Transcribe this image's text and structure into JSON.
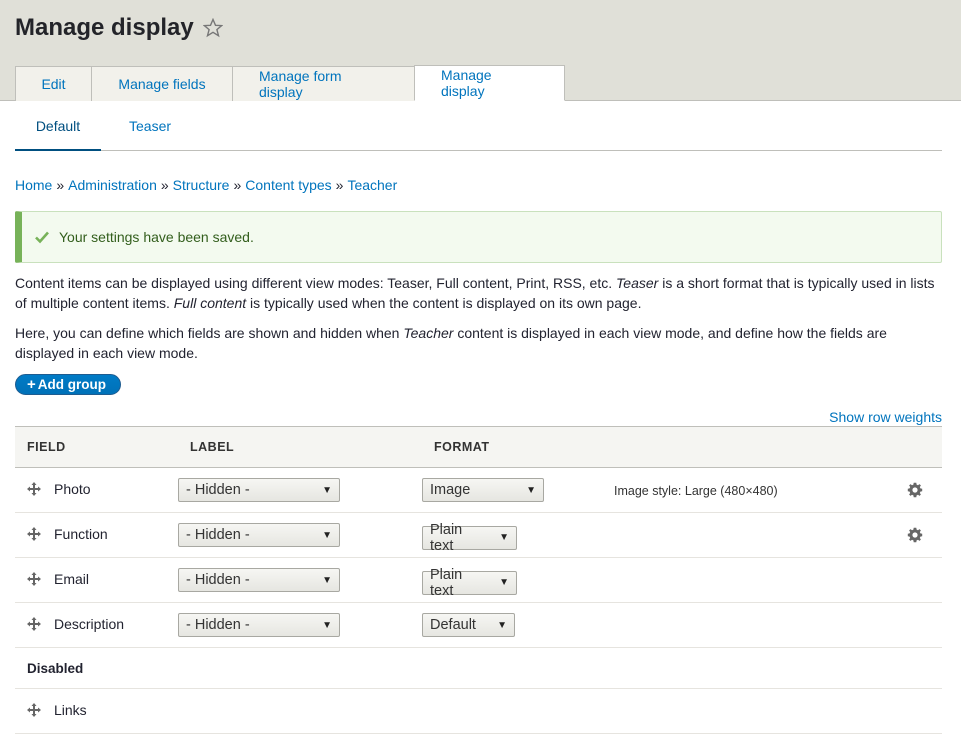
{
  "page": {
    "title": "Manage display"
  },
  "primary_tabs": [
    {
      "label": "Edit",
      "active": false
    },
    {
      "label": "Manage fields",
      "active": false
    },
    {
      "label": "Manage form display",
      "active": false
    },
    {
      "label": "Manage display",
      "active": true
    }
  ],
  "secondary_tabs": [
    {
      "label": "Default",
      "active": true
    },
    {
      "label": "Teaser",
      "active": false
    }
  ],
  "breadcrumb": {
    "items": [
      "Home",
      "Administration",
      "Structure",
      "Content types",
      "Teacher"
    ],
    "separator": "»"
  },
  "message": {
    "text": "Your settings have been saved."
  },
  "help": {
    "p1_a": "Content items can be displayed using different view modes: Teaser, Full content, Print, RSS, etc. ",
    "p1_b": "Teaser",
    "p1_c": " is a short format that is typically used in lists of multiple content items. ",
    "p1_d": "Full content",
    "p1_e": " is typically used when the content is displayed on its own page.",
    "p2_a": "Here, you can define which fields are shown and hidden when ",
    "p2_b": "Teacher",
    "p2_c": " content is displayed in each view mode, and define how the fields are displayed in each view mode."
  },
  "add_group": {
    "plus": "+",
    "label": "Add group"
  },
  "row_weights_link": "Show row weights",
  "table": {
    "headers": {
      "field": "Field",
      "label": "Label",
      "format": "Format"
    },
    "rows": [
      {
        "field": "Photo",
        "label": "- Hidden -",
        "format": "Image",
        "summary": "Image style: Large (480×480)",
        "has_settings": true
      },
      {
        "field": "Function",
        "label": "- Hidden -",
        "format": "Plain text",
        "summary": "",
        "has_settings": true
      },
      {
        "field": "Email",
        "label": "- Hidden -",
        "format": "Plain text",
        "summary": "",
        "has_settings": false
      },
      {
        "field": "Description",
        "label": "- Hidden -",
        "format": "Default",
        "summary": "",
        "has_settings": false
      }
    ],
    "disabled_region": "Disabled",
    "disabled_rows": [
      {
        "field": "Links"
      }
    ]
  },
  "colors": {
    "link": "#0074bd",
    "primary_button": "#0071b8",
    "success_border": "#77b259",
    "header_bg": "#e0e0d8"
  },
  "icons": [
    "star-icon",
    "check-icon",
    "drag-icon",
    "gear-icon",
    "chevron-down-icon"
  ]
}
